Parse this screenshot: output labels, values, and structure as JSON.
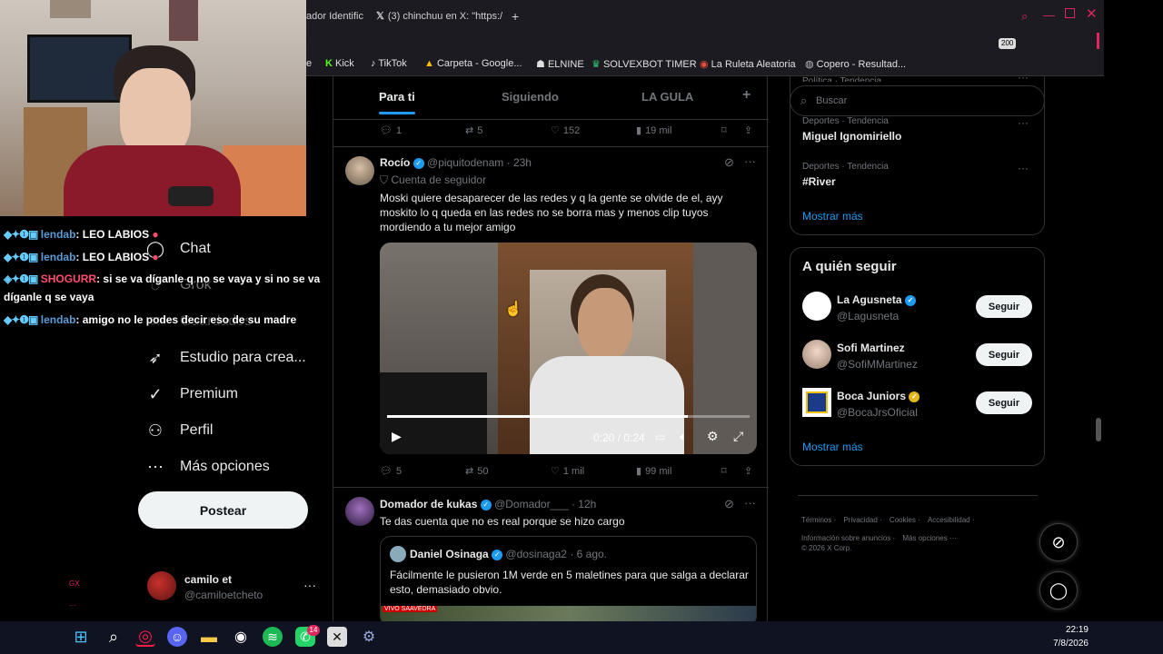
{
  "browser": {
    "tabs": [
      {
        "label": "ador Identific"
      },
      {
        "label": "(3) chinchuu en X: \"https:/"
      }
    ],
    "bookmarks": [
      "e",
      "Kick",
      "TikTok",
      "Carpeta - Google...",
      "ELNINE",
      "SOLVEXBOT TIMER",
      "La Ruleta Aleatoria",
      "Copero - Resultad..."
    ],
    "badge_count": "200"
  },
  "nav": {
    "items": [
      "Chat",
      "Grok",
      "Guardados",
      "Estudio para crea...",
      "Premium",
      "Perfil",
      "Más opciones"
    ],
    "post_button": "Postear",
    "account_name": "camilo et",
    "account_handle": "@camiloetcheto"
  },
  "feed": {
    "tabs": [
      "Para ti",
      "Siguiendo",
      "LA GULA"
    ],
    "add_tab": "+",
    "prev_actions": {
      "replies": "1",
      "reposts": "5",
      "likes": "152",
      "views": "19 mil"
    },
    "tweet1": {
      "name": "Rocío",
      "handle": "@piquitodenam",
      "time": "· 23h",
      "context": "Cuenta de seguidor",
      "text": "Moski quiere desaparecer de las redes y q la gente se olvide de el, ayy moskito lo q queda en las redes no se borra mas y menos clip tuyos mordiendo a tu mejor amigo",
      "video_time": "0:20 / 0:24",
      "video_progress": 0.83,
      "actions": {
        "replies": "5",
        "reposts": "50",
        "likes": "1 mil",
        "views": "99 mil"
      }
    },
    "tweet2": {
      "name": "Domador de kukas",
      "handle": "@Domador___",
      "time": "· 12h",
      "text": "Te das cuenta que no es real porque se hizo cargo",
      "quote_name": "Daniel Osinaga",
      "quote_handle": "@dosinaga2",
      "quote_time": "· 6 ago.",
      "quote_text": "Fácilmente le pusieron 1M verde en 5 maletines para que salga a declarar esto, demasiado obvio.",
      "quote_thumb_label": "VIVO SAAVEDRA"
    }
  },
  "right": {
    "search_placeholder": "Buscar",
    "trends_top_cat": "Política · Tendencia",
    "trends": [
      {
        "category": "Deportes · Tendencia",
        "name": "Miguel Ignomiriello"
      },
      {
        "category": "Deportes · Tendencia",
        "name": "#River"
      }
    ],
    "show_more": "Mostrar más",
    "who_to_follow_title": "A quién seguir",
    "follow": [
      {
        "name": "La Agusneta",
        "handle": "@Lagusneta",
        "button": "Seguir"
      },
      {
        "name": "Sofi Martinez",
        "handle": "@SofiMMartinez",
        "button": "Seguir"
      },
      {
        "name": "Boca Juniors",
        "handle": "@BocaJrsOficial",
        "button": "Seguir"
      }
    ],
    "show_more2": "Mostrar más",
    "footer_links": [
      "Términos",
      "Privacidad",
      "Cookies",
      "Accesibilidad",
      "Información sobre anuncios",
      "Más opciones ···"
    ],
    "copyright": "© 2026 X Corp."
  },
  "chat": {
    "lines": [
      {
        "user": "lendab",
        "color": "#5b9bd5",
        "message": ": LEO LABIOS"
      },
      {
        "user": "lendab",
        "color": "#5b9bd5",
        "message": ": LEO LABIOS"
      },
      {
        "user": "SHOGURR",
        "color": "#ff4d6d",
        "message": ": si se va díganle q no se vaya y si no se va díganle q se vaya"
      },
      {
        "user": "lendab",
        "color": "#5b9bd5",
        "message": ": amigo no le podes decir eso de su madre"
      }
    ]
  },
  "taskbar": {
    "time": "22:19",
    "date": "7/8/2026",
    "whatsapp_badge": "14"
  }
}
